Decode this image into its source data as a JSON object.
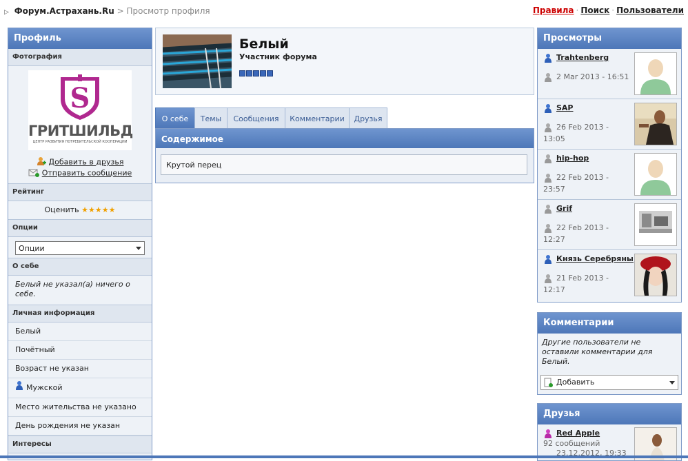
{
  "breadcrumb": {
    "home": "Форум.Астрахань.Ru",
    "separator": ">",
    "current": "Просмотр профиля"
  },
  "toplinks": {
    "rules": "Правила",
    "search": "Поиск",
    "users": "Пользователи",
    "sep": "·"
  },
  "left": {
    "title": "Профиль",
    "photo_label": "Фотография",
    "logo_brand": "ГРИТШИЛЬД",
    "logo_tagline": "ЦЕНТР РАЗВИТИЯ ПОТРЕБИТЕЛЬСКОЙ КООПЕРАЦИИ",
    "add_friend": "Добавить в друзья",
    "send_message": "Отправить сообщение",
    "rating_label": "Рейтинг",
    "rate_text": "Оценить",
    "stars": "★★★★★",
    "options_label": "Опции",
    "options_value": "Опции",
    "about_label": "О себе",
    "about_text": "Белый не указал(а) ничего о себе.",
    "personal_label": "Личная информация",
    "personal": [
      "Белый",
      "Почётный",
      "Возраст не указан",
      "Мужской",
      "Место жительства не указано",
      "День рождения не указан"
    ],
    "interests_label": "Интересы"
  },
  "profile": {
    "name": "Белый",
    "status": "Участник форума",
    "tabs": [
      "О себе",
      "Темы",
      "Сообщения",
      "Комментарии",
      "Друзья"
    ],
    "content_title": "Содержимое",
    "content_text": "Крутой перец"
  },
  "views": {
    "title": "Просмотры",
    "items": [
      {
        "name": "Trahtenberg",
        "date": "2 Mar 2013 - 16:51"
      },
      {
        "name": "SAP",
        "date": "26 Feb 2013 - 13:05"
      },
      {
        "name": "hip-hop",
        "date": "22 Feb 2013 - 23:57"
      },
      {
        "name": "Grif",
        "date": "22 Feb 2013 - 12:27"
      },
      {
        "name": "Князь Серебряный",
        "date": "21 Feb 2013 - 12:17"
      }
    ]
  },
  "comments": {
    "title": "Комментарии",
    "text": "Другие пользователи не оставили комментарии для Белый.",
    "add": "Добавить"
  },
  "friends": {
    "title": "Друзья",
    "items": [
      {
        "name": "Red Apple",
        "count": "92 сообщений",
        "date": "23.12.2012, 19:33"
      }
    ]
  },
  "colors": {
    "accent": "#4d77b8",
    "rules_link": "#cc0000",
    "star": "#f0a000"
  }
}
